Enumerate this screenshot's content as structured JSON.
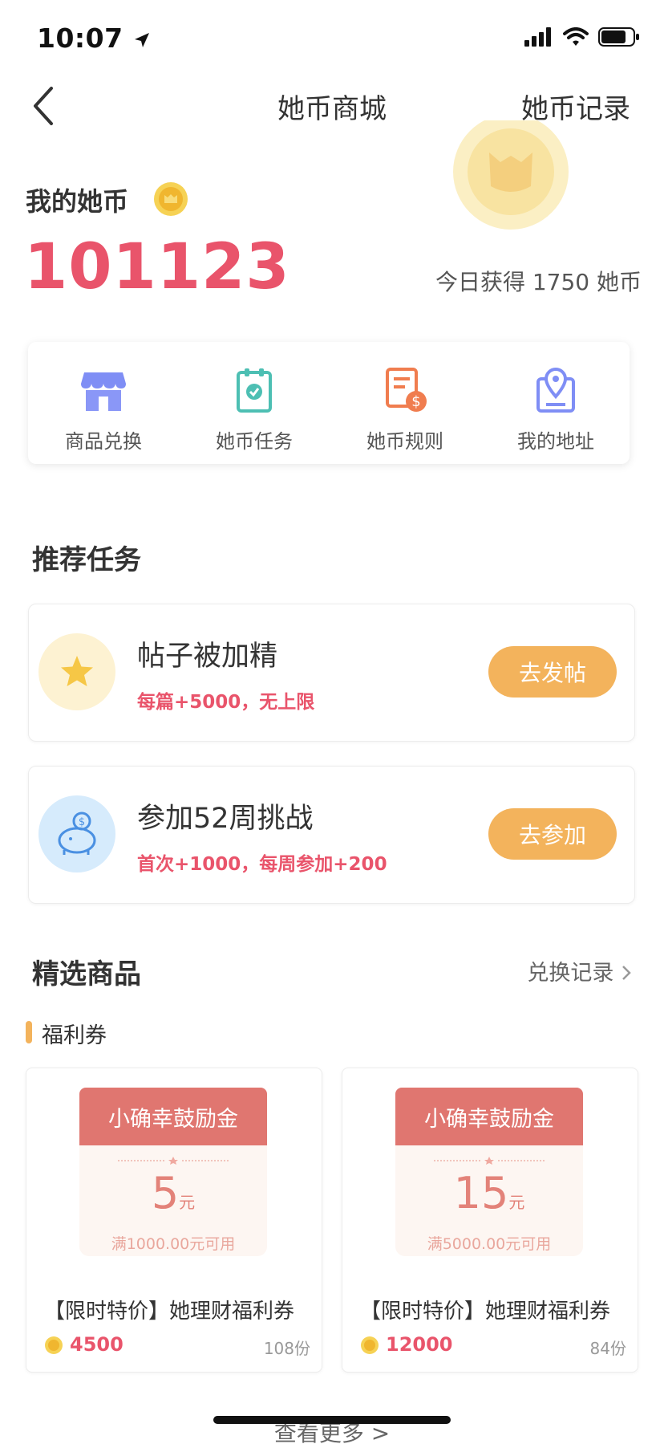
{
  "status_bar": {
    "time": "10:07"
  },
  "nav": {
    "title": "她币商城",
    "right_label": "她币记录"
  },
  "balance": {
    "label": "我的她币",
    "amount": "101123",
    "today_text": "今日获得 1750 她币"
  },
  "quick_actions": [
    {
      "label": "商品兑换",
      "icon": "store-icon"
    },
    {
      "label": "她币任务",
      "icon": "task-clipboard-icon"
    },
    {
      "label": "她币规则",
      "icon": "rules-doc-icon"
    },
    {
      "label": "我的地址",
      "icon": "location-icon"
    }
  ],
  "recommended": {
    "title": "推荐任务",
    "tasks": [
      {
        "title": "帖子被加精",
        "desc": "每篇+5000，无上限",
        "button": "去发帖",
        "icon": "star-icon"
      },
      {
        "title": "参加52周挑战",
        "desc": "首次+1000，每周参加+200",
        "button": "去参加",
        "icon": "piggy-bank-icon"
      }
    ]
  },
  "goods": {
    "title": "精选商品",
    "more_label": "兑换记录",
    "category": "福利券",
    "items": [
      {
        "coupon_title": "小确幸鼓励金",
        "amount": "5",
        "unit": "元",
        "condition": "满1000.00元可用",
        "name": "【限时特价】她理财福利券",
        "price": "4500",
        "stock": "108份"
      },
      {
        "coupon_title": "小确幸鼓励金",
        "amount": "15",
        "unit": "元",
        "condition": "满5000.00元可用",
        "name": "【限时特价】她理财福利券",
        "price": "12000",
        "stock": "84份"
      }
    ]
  },
  "footer": {
    "see_more": "查看更多 >"
  },
  "colors": {
    "accent_red": "#e9546b",
    "button_orange": "#f3b35c",
    "coupon_red": "#e07670"
  }
}
